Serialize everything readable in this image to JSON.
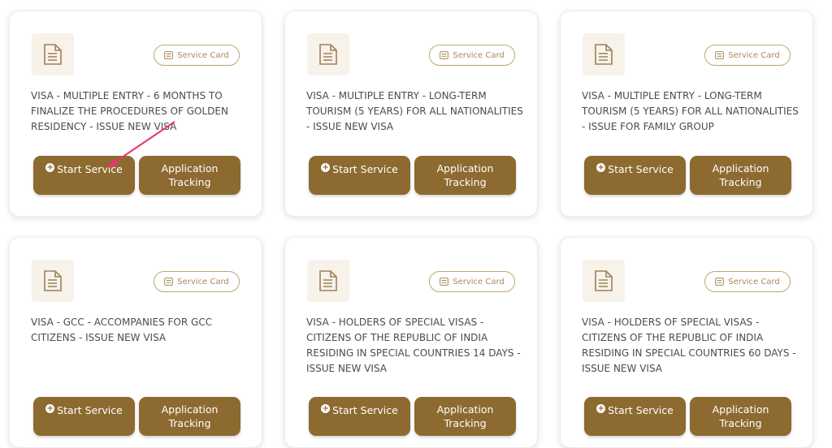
{
  "cards": [
    {
      "badge": "Service Card",
      "title": "VISA - MULTIPLE ENTRY - 6 MONTHS TO FINALIZE THE PROCEDURES OF GOLDEN RESIDENCY - ISSUE NEW VISA",
      "start_label": "Start Service",
      "track_line1": "Application",
      "track_line2": "Tracking"
    },
    {
      "badge": "Service Card",
      "title": "VISA - MULTIPLE ENTRY - LONG-TERM TOURISM (5 YEARS) FOR ALL NATIONALITIES - ISSUE NEW VISA",
      "start_label": "Start Service",
      "track_line1": "Application",
      "track_line2": "Tracking"
    },
    {
      "badge": "Service Card",
      "title": "VISA - MULTIPLE ENTRY - LONG-TERM TOURISM (5 YEARS) FOR ALL NATIONALITIES - ISSUE FOR FAMILY GROUP",
      "start_label": "Start Service",
      "track_line1": "Application",
      "track_line2": "Tracking"
    },
    {
      "badge": "Service Card",
      "title": "VISA - GCC - ACCOMPANIES FOR GCC CITIZENS - ISSUE NEW VISA",
      "start_label": "Start Service",
      "track_line1": "Application",
      "track_line2": "Tracking"
    },
    {
      "badge": "Service Card",
      "title": "VISA - HOLDERS OF SPECIAL VISAS - CITIZENS OF THE REPUBLIC OF INDIA RESIDING IN SPECIAL COUNTRIES 14 DAYS - ISSUE NEW VISA",
      "start_label": "Start Service",
      "track_line1": "Application",
      "track_line2": "Tracking"
    },
    {
      "badge": "Service Card",
      "title": "VISA - HOLDERS OF SPECIAL VISAS - CITIZENS OF THE REPUBLIC OF INDIA RESIDING IN SPECIAL COUNTRIES 60 DAYS - ISSUE NEW VISA",
      "start_label": "Start Service",
      "track_line1": "Application",
      "track_line2": "Tracking"
    }
  ],
  "icons": {
    "card_icon": "document-icon",
    "badge_icon": "service-card-icon",
    "start_icon": "plus-circle-icon",
    "annotation": "pointer-arrow"
  },
  "colors": {
    "brand": "#8d6a30",
    "badge_border": "#bfa579",
    "doc_bg": "#f7f2ea",
    "annotation_arrow": "#e8346e"
  }
}
